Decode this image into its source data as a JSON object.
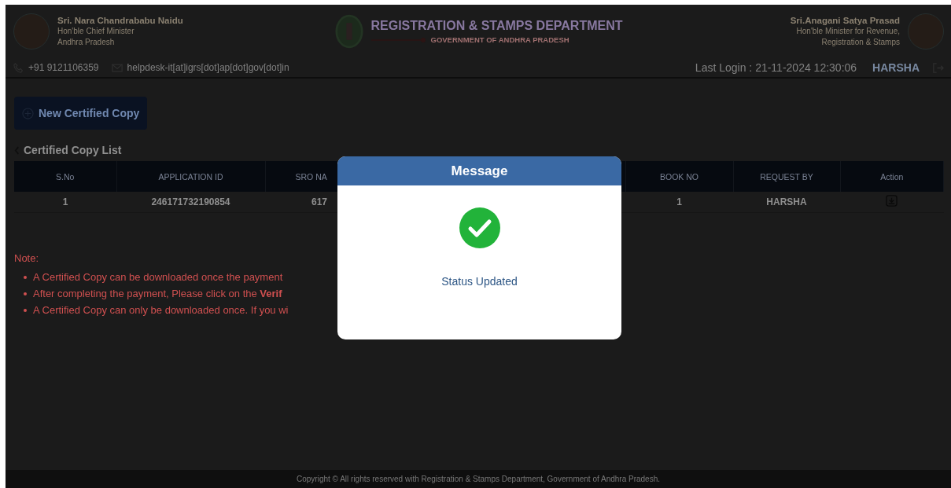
{
  "header": {
    "left_official": {
      "name": "Sri. Nara Chandrababu Naidu",
      "lines": [
        "Hon'ble Chief Minister",
        "Andhra Pradesh"
      ]
    },
    "department": {
      "title": "REGISTRATION & STAMPS DEPARTMENT",
      "subtitle": "GOVERNMENT OF ANDHRA PRADESH"
    },
    "right_official": {
      "name": "Sri.Anagani Satya Prasad",
      "lines": [
        "Hon'ble Minister for Revenue,",
        "Registration & Stamps"
      ]
    },
    "phone": "+91 9121106359",
    "email": "helpdesk-it[at]igrs[dot]ap[dot]gov[dot]in",
    "last_login": "Last Login : 21-11-2024 12:30:06",
    "user": "HARSHA"
  },
  "new_button": "New Certified Copy",
  "list_title": "Certified Copy List",
  "table": {
    "columns": [
      "S.No",
      "APPLICATION ID",
      "SRO NA",
      "BOOK NO",
      "REQUEST BY",
      "Action"
    ],
    "rows": [
      {
        "cells": [
          "1",
          "246171732190854",
          "617",
          "1",
          "HARSHA"
        ]
      }
    ]
  },
  "note": {
    "title": "Note:",
    "items": [
      "A Certified Copy can be downloaded once the payment",
      "After completing the payment, Please click on the **Verif**",
      "A Certified Copy can only be downloaded once. If you wi"
    ]
  },
  "footer": "Copyright © All rights reserved with Registration & Stamps Department, Government of Andhra Pradesh.",
  "modal": {
    "title": "Message",
    "message": "Status Updated"
  }
}
